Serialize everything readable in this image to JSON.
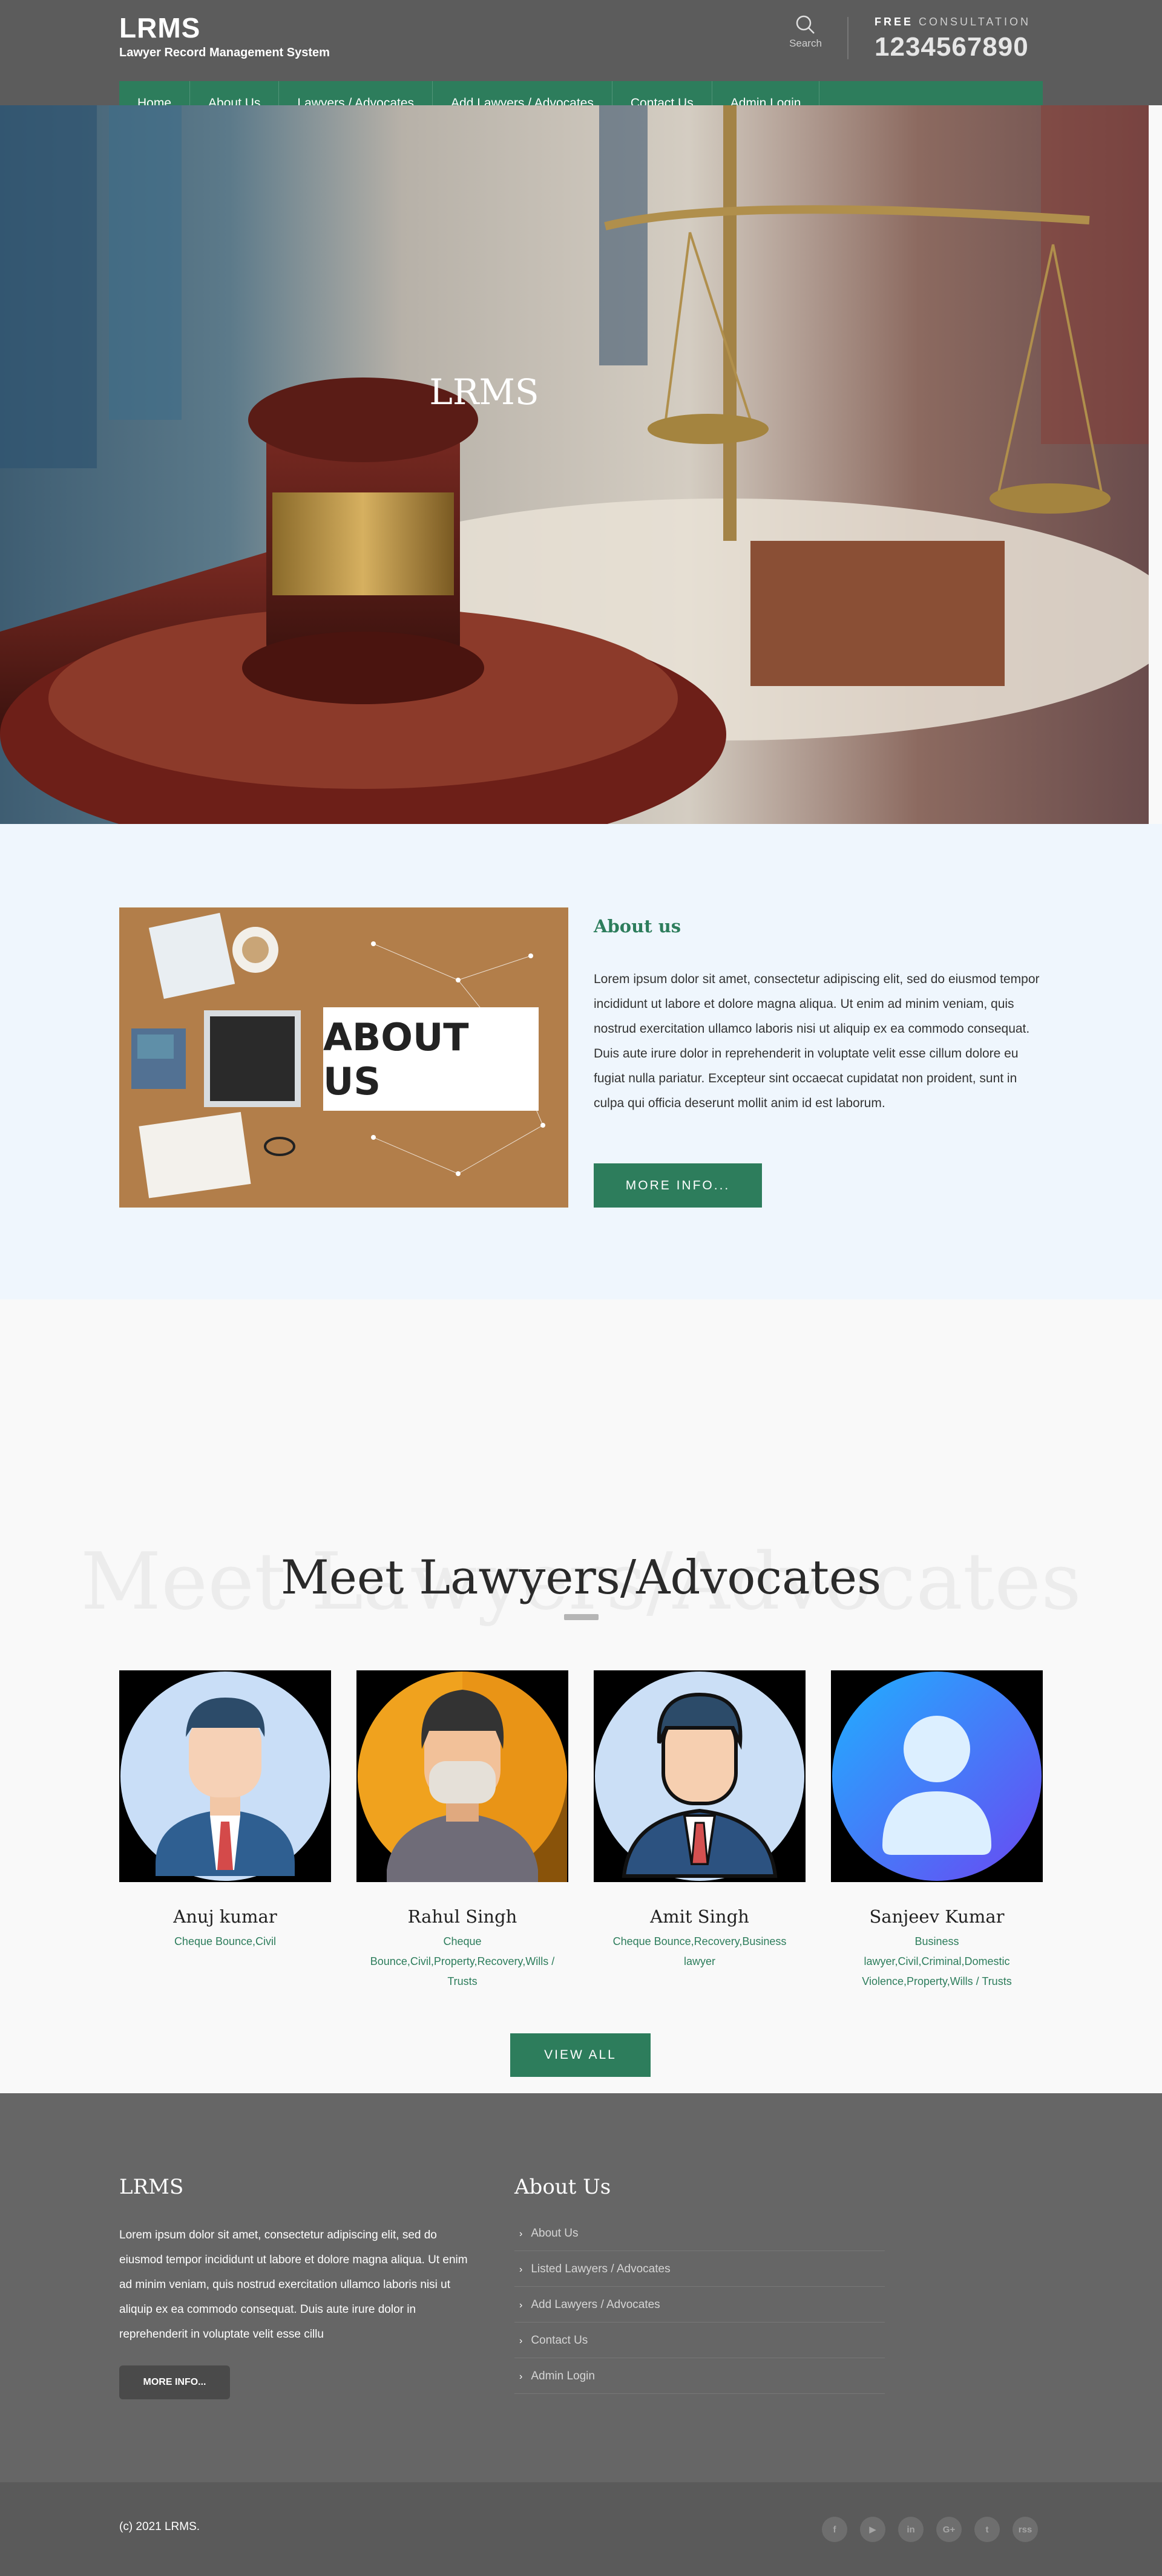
{
  "header": {
    "brand": "LRMS",
    "brand_sub": "Lawyer Record Management System",
    "search_label": "Search",
    "consult_free": "FREE",
    "consult_label": "CONSULTATION",
    "phone": "1234567890"
  },
  "nav": {
    "items": [
      "Home",
      "About Us",
      "Lawyers / Advocates",
      "Add Lawyers / Advocates",
      "Contact Us",
      "Admin Login"
    ]
  },
  "hero": {
    "title": "LRMS"
  },
  "about": {
    "image_text": "ABOUT US",
    "heading": "About us",
    "text": "Lorem ipsum dolor sit amet, consectetur adipiscing elit, sed do eiusmod tempor incididunt ut labore et dolore magna aliqua. Ut enim ad minim veniam, quis nostrud exercitation ullamco laboris nisi ut aliquip ex ea commodo consequat. Duis aute irure dolor in reprehenderit in voluptate velit esse cillum dolore eu fugiat nulla pariatur. Excepteur sint occaecat cupidatat non proident, sunt in culpa qui officia deserunt mollit anim id est laborum.",
    "button": "MORE INFO..."
  },
  "lawyers": {
    "ghost_title": "Meet Lawyers/Advocates",
    "title": "Meet Lawyers/Advocates",
    "cards": [
      {
        "name": "Anuj kumar",
        "spec": "Cheque Bounce,Civil",
        "avatar": "man-suit-avatar-icon"
      },
      {
        "name": "Rahul Singh",
        "spec": "Cheque Bounce,Civil,Property,Recovery,Wills / Trusts",
        "avatar": "man-mask-avatar-icon"
      },
      {
        "name": "Amit Singh",
        "spec": "Cheque Bounce,Recovery,Business lawyer",
        "avatar": "man-tie-avatar-icon"
      },
      {
        "name": "Sanjeev Kumar",
        "spec": "Business lawyer,Civil,Criminal,Domestic Violence,Property,Wills / Trusts",
        "avatar": "user-placeholder-icon"
      }
    ],
    "button": "VIEW ALL"
  },
  "footer": {
    "brand": "LRMS",
    "text": "Lorem ipsum dolor sit amet, consectetur adipiscing elit, sed do eiusmod tempor incididunt ut labore et dolore magna aliqua. Ut enim ad minim veniam, quis nostrud exercitation ullamco laboris nisi ut aliquip ex ea commodo consequat. Duis aute irure dolor in reprehenderit in voluptate velit esse cillu",
    "button": "MORE INFO...",
    "links_title": "About Us",
    "links": [
      "About Us",
      "Listed Lawyers / Advocates",
      "Add Lawyers / Advocates",
      "Contact Us",
      "Admin Login"
    ],
    "copyright": "(c) 2021 LRMS.",
    "socials": [
      "f",
      "▶",
      "in",
      "G+",
      "t",
      "rss"
    ]
  },
  "colors": {
    "accent_green": "#2d7d5c",
    "header_gray": "#5c5c5c",
    "about_bg": "#eff6fd"
  }
}
